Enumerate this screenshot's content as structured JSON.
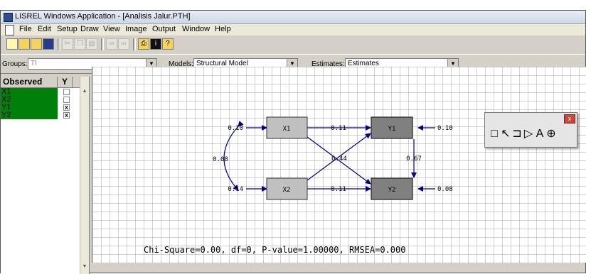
{
  "overlay_text": "                              ",
  "window": {
    "title": "LISREL Windows Application - [Analisis Jalur.PTH]"
  },
  "menu": [
    "File",
    "Edit",
    "Setup",
    "Draw",
    "View",
    "Image",
    "Output",
    "Window",
    "Help"
  ],
  "toolbar_icons": [
    "new-file-icon",
    "open-file-icon",
    "save-icon",
    "disk-icon",
    "cut-icon",
    "copy-icon",
    "paste-icon",
    "run-icon",
    "run-all-icon",
    "print-icon",
    "info-icon",
    "help-icon"
  ],
  "groupbar": {
    "groups_label": "Groups:",
    "groups_value": "TI",
    "models_label": "Models:",
    "models_value": "Structural Model",
    "estimates_label": "Estimates:",
    "estimates_value": "Estimates"
  },
  "variables": {
    "header_observed": "Observed",
    "header_y": "Y",
    "rows": [
      {
        "name": "X1",
        "y": false
      },
      {
        "name": "X2",
        "y": false
      },
      {
        "name": "Y1",
        "y": true
      },
      {
        "name": "Y2",
        "y": true
      }
    ],
    "check_mark": "x"
  },
  "diagram": {
    "nodes": {
      "x1": "X1",
      "x2": "X2",
      "y1": "Y1",
      "y2": "Y2"
    },
    "labels": {
      "x1_var": "0.10",
      "x2_var": "0.14",
      "cov_x1_x2": "0.08",
      "x1_y1": "0.11",
      "x2_y2": "0.11",
      "cross": "0.44",
      "y1_y2": "0.67",
      "y1_err": "0.10",
      "y2_err": "0.08"
    },
    "fit": "Chi-Square=0.00, df=0, P-value=1.00000, RMSEA=0.000"
  },
  "palette": {
    "close": "x",
    "tool_icons": [
      "select-box-icon",
      "arrow-pointer-icon",
      "bracket-icon",
      "triangle-icon",
      "text-icon",
      "zoom-icon"
    ],
    "tool_glyphs": [
      "□",
      "↖",
      "⊐",
      "▷",
      "A",
      "⊕"
    ]
  },
  "colors": {
    "variable_green": "#00800a",
    "path_blue": "#000080",
    "x_node": "#c0c0c0",
    "y_node": "#808080"
  }
}
